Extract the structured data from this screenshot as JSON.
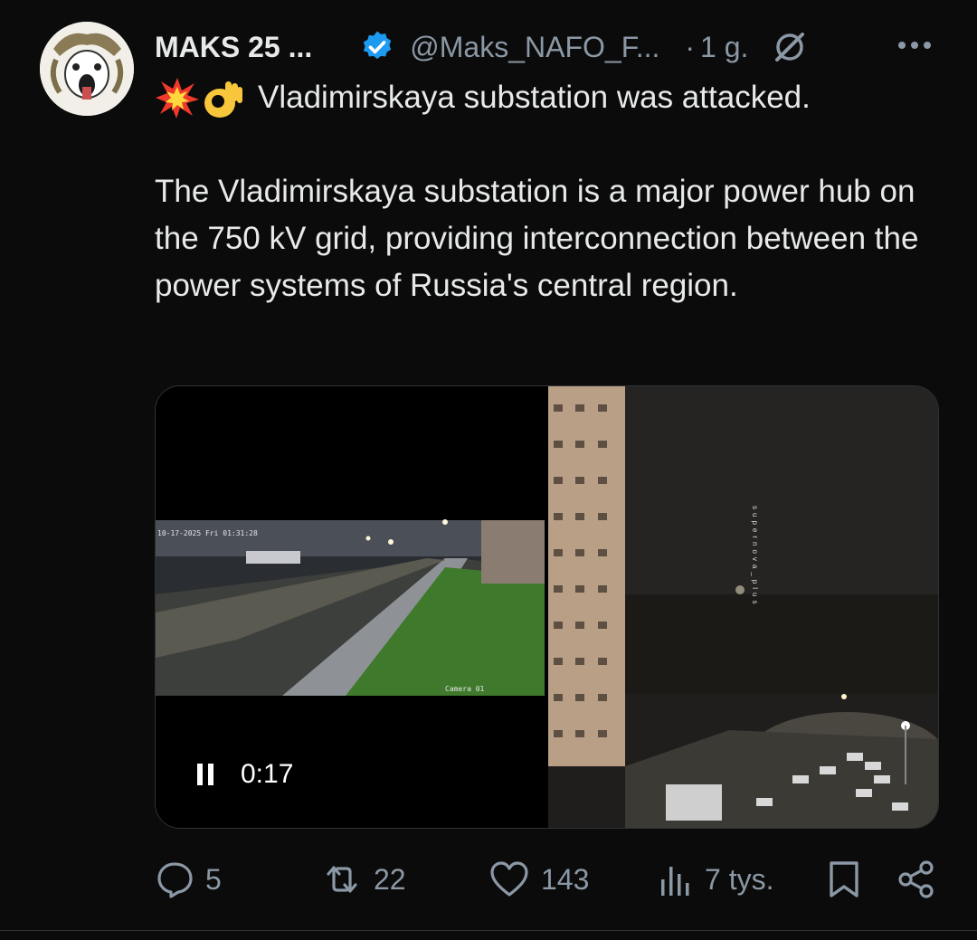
{
  "post": {
    "author_name": "MAKS 25 ...",
    "handle": "@Maks_NAFO_F...",
    "separator": "·",
    "time": "1 g.",
    "first_line": "Vladimirskaya substation was attacked.",
    "emojis": [
      "collision-emoji",
      "ok-hand-emoji"
    ],
    "body": "The Vladimirskaya substation is a major power hub on the 750 kV grid, providing interconnection between the power systems of Russia's central region."
  },
  "media": {
    "video_time": "0:17",
    "cctv_timestamp": "10-17-2025 Fri 01:31:28",
    "cctv_camera": "Camera 01",
    "watermark": "supernova_plus"
  },
  "actions": {
    "replies": "5",
    "reposts": "22",
    "likes": "143",
    "views": "7 tys."
  },
  "colors": {
    "background": "#0b0b0b",
    "text": "#e7e9ea",
    "muted": "#8b98a5",
    "verified": "#1d9bf0"
  }
}
